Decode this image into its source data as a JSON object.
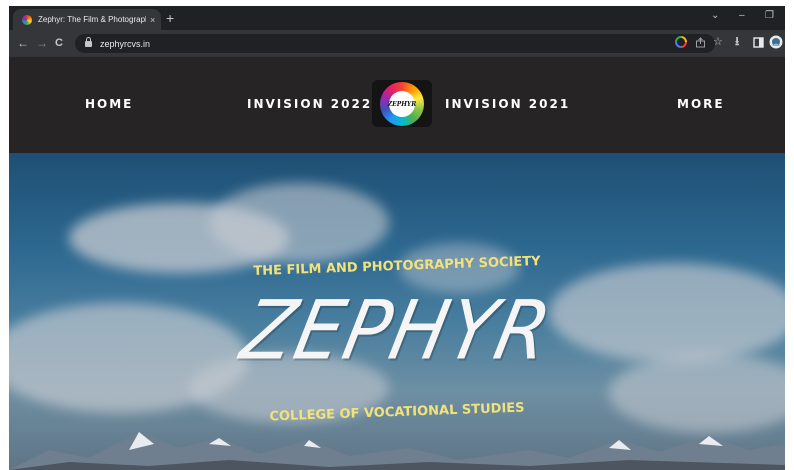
{
  "browser": {
    "tab_title": "Zephyr: The Film & Photography",
    "tab_close": "×",
    "new_tab": "+",
    "url": "zephyrcvs.in",
    "nav": {
      "back": "←",
      "forward": "→",
      "reload": "C"
    },
    "window_controls": {
      "dropdown": "⌄",
      "minimize": "–",
      "restore": "❐"
    },
    "toolbar_icons": [
      "google-icon",
      "share-icon",
      "bookmark-star-icon",
      "download-icon",
      "sidepanel-icon",
      "profile-icon"
    ],
    "bookmark_star": "☆",
    "download": "⭳"
  },
  "site": {
    "nav": {
      "home": "HOME",
      "invision_2022": "INVISION 2022",
      "invision_2021": "INVISION 2021",
      "more": "MORE"
    },
    "logo_text": "ZEPHYR",
    "hero": {
      "tagline": "THE FILM AND PHOTOGRAPHY SOCIETY",
      "title": "ZEPHYR",
      "college": "COLLEGE OF VOCATIONAL STUDIES"
    }
  },
  "colors": {
    "header_bg": "#262424",
    "hero_text_yellow": "#f1e27a",
    "sky_top": "#1e4f73",
    "chrome_toolbar": "#35363a"
  }
}
